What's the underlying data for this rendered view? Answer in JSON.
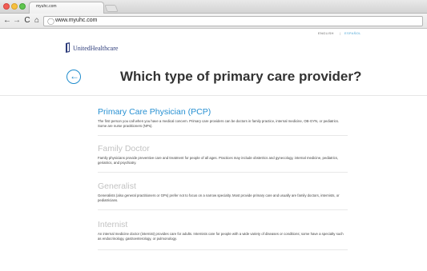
{
  "browser": {
    "tab_title": "myuhc.com",
    "url": "www.myuhc.com",
    "nav": {
      "back": "←",
      "forward": "→",
      "reload": "C",
      "home": "⌂"
    },
    "globe_glyph": "◯"
  },
  "header": {
    "lang_english": "ENGLISH",
    "lang_separator": "|",
    "lang_spanish": "ESPAÑOL",
    "logo_text": "UnitedHealthcare",
    "logo_color": "#2c3b7a"
  },
  "hero": {
    "title": "Which type of primary care provider?",
    "back_arrow": "←",
    "accent_color": "#1f8ccd"
  },
  "options": [
    {
      "title": "Primary Care Physician (PCP)",
      "description": "The first person you call when you have a medical concern. Primary care providers can be doctors in family practice, internal medicine, OB-GYN, or pediatrics. Some are nurse practitioners (NPs)."
    },
    {
      "title": "Family Doctor",
      "description": "Family physicians provide preventive care and treatment for people of all ages. Practices may include obstetrics and gynecology, internal medicine, pediatrics, geriatrics, and psychiatry."
    },
    {
      "title": "Generalist",
      "description": "Generalists (also general practitioners or GPs) prefer not to focus on a narrow specialty. Most provide primary care and usually are family doctors, internists, or pediatricians."
    },
    {
      "title": "Internist",
      "description": "An internal medicine doctor (internist) provides care for adults. Internists care for people with a wide variety of diseases or conditions; some have a specialty such as endocrinology, gastroenterology, or pulmonology."
    }
  ]
}
